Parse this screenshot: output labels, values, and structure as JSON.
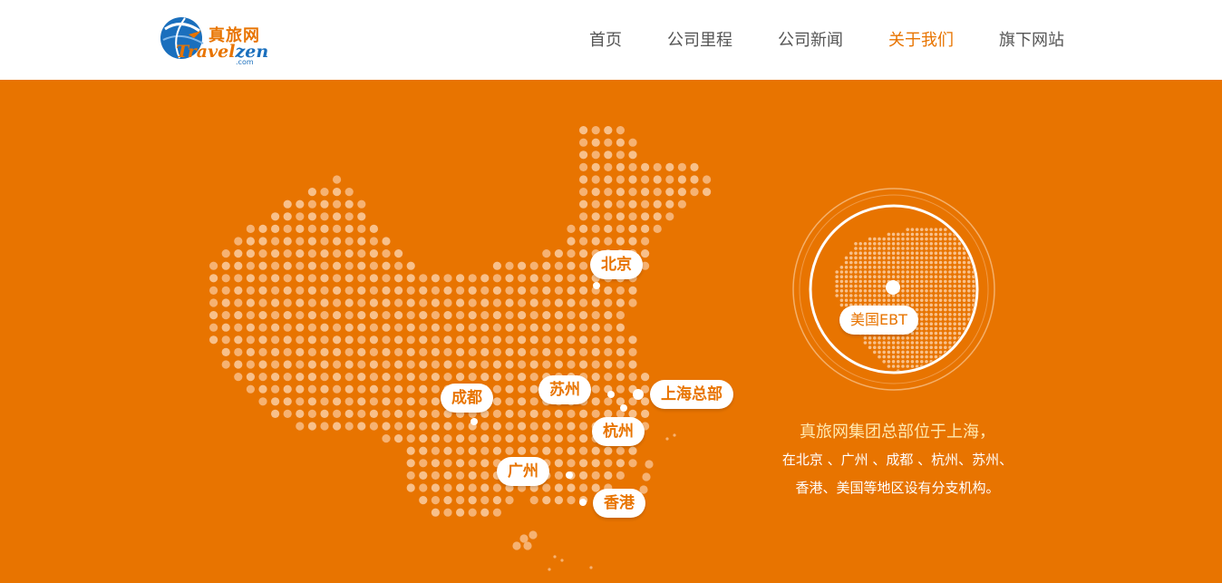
{
  "brand": {
    "name_cn": "真旅网",
    "name_en_travel": "Travel",
    "name_en_zen": "zen",
    "domain_suffix": ".com",
    "colors": {
      "accent": "#e87400",
      "blue": "#1a6fbd",
      "caption": "#ffe9b0"
    }
  },
  "nav": [
    {
      "label": "首页",
      "active": false
    },
    {
      "label": "公司里程",
      "active": false
    },
    {
      "label": "公司新闻",
      "active": false
    },
    {
      "label": "关于我们",
      "active": true
    },
    {
      "label": "旗下网站",
      "active": false
    }
  ],
  "map": {
    "cities": [
      {
        "label": "北京"
      },
      {
        "label": "成都"
      },
      {
        "label": "苏州"
      },
      {
        "label": "上海总部"
      },
      {
        "label": "杭州"
      },
      {
        "label": "广州"
      },
      {
        "label": "香港"
      }
    ],
    "overseas": {
      "label": "美国EBT"
    }
  },
  "caption": {
    "line1": "真旅网集团总部位于上海，",
    "line2": "在北京 、广州 、成都 、杭州、苏州、",
    "line3": "香港、美国等地区设有分支机构。"
  }
}
